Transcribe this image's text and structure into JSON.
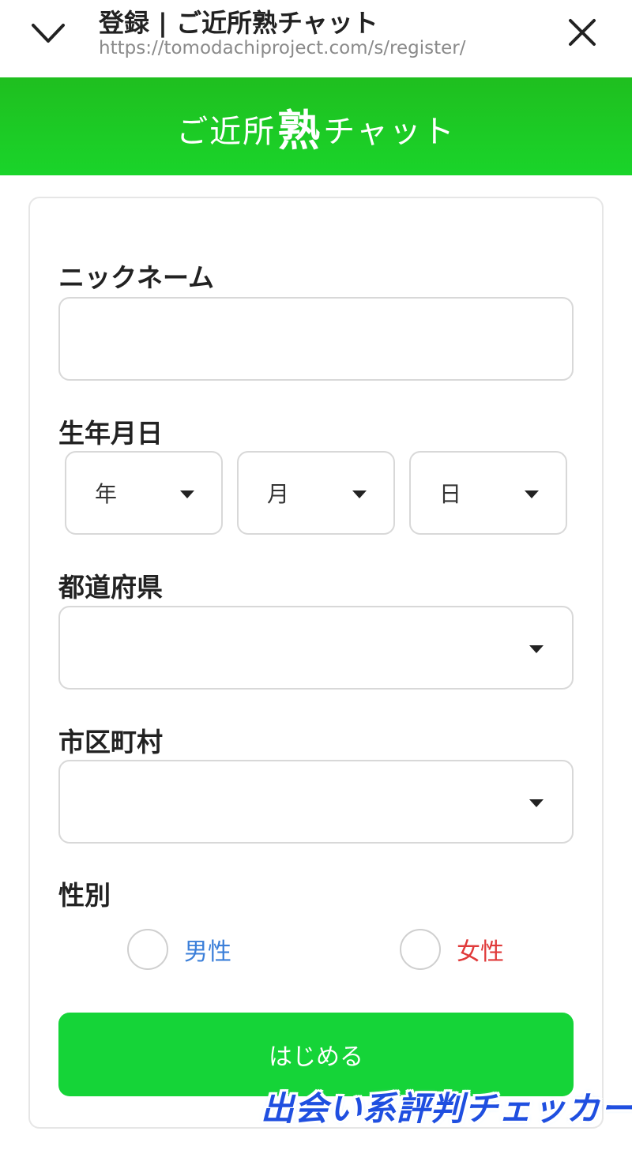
{
  "browser": {
    "page_title": "登録 | ご近所熟チャット",
    "url": "https://tomodachiproject.com/s/register/",
    "icons": {
      "collapse": "chevron-down-icon",
      "close": "close-icon"
    }
  },
  "header": {
    "logo_prefix": "ご近所",
    "logo_emphasis": "熟",
    "logo_suffix": "チャット",
    "background_color": "#1ad42a"
  },
  "form": {
    "nickname": {
      "label": "ニックネーム",
      "value": "",
      "placeholder": ""
    },
    "birthday": {
      "label": "生年月日",
      "year": "年",
      "month": "月",
      "day": "日"
    },
    "prefecture": {
      "label": "都道府県",
      "value": ""
    },
    "city": {
      "label": "市区町村",
      "value": ""
    },
    "gender": {
      "label": "性別",
      "male": {
        "label": "男性",
        "color": "#3b7fd9"
      },
      "female": {
        "label": "女性",
        "color": "#e03a3a"
      }
    },
    "submit_label": "はじめる",
    "submit_color": "#15d438"
  },
  "watermark": "出会い系評判チェッカー"
}
